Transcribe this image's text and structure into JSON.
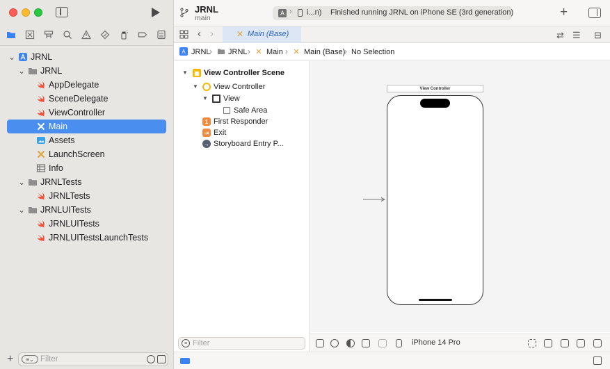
{
  "sidebar": {
    "nav_tabs": [
      "project-navigator",
      "source-control",
      "symbol-navigator",
      "find-navigator",
      "issue-navigator",
      "test-navigator",
      "debug-navigator",
      "breakpoint-navigator",
      "report-navigator"
    ],
    "tree": [
      {
        "label": "JRNL",
        "icon": "app-project-icon",
        "level": 0,
        "disclosure": "open"
      },
      {
        "label": "JRNL",
        "icon": "folder-icon",
        "level": 1,
        "disclosure": "open"
      },
      {
        "label": "AppDelegate",
        "icon": "swift-icon",
        "level": 2
      },
      {
        "label": "SceneDelegate",
        "icon": "swift-icon",
        "level": 2
      },
      {
        "label": "ViewController",
        "icon": "swift-icon",
        "level": 2
      },
      {
        "label": "Main",
        "icon": "storyboard-icon",
        "level": 2,
        "selected": true
      },
      {
        "label": "Assets",
        "icon": "assets-icon",
        "level": 2
      },
      {
        "label": "LaunchScreen",
        "icon": "storyboard-icon",
        "level": 2
      },
      {
        "label": "Info",
        "icon": "plist-icon",
        "level": 2
      },
      {
        "label": "JRNLTests",
        "icon": "folder-icon",
        "level": 1,
        "disclosure": "open"
      },
      {
        "label": "JRNLTests",
        "icon": "swift-icon",
        "level": 2
      },
      {
        "label": "JRNLUITests",
        "icon": "folder-icon",
        "level": 1,
        "disclosure": "open"
      },
      {
        "label": "JRNLUITests",
        "icon": "swift-icon",
        "level": 2
      },
      {
        "label": "JRNLUITestsLaunchTests",
        "icon": "swift-icon",
        "level": 2
      }
    ],
    "filter_placeholder": "Filter"
  },
  "toolbar": {
    "project_title": "JRNL",
    "branch": "main",
    "scheme_device_short": "i...n)",
    "status": "Finished running JRNL on iPhone SE (3rd generation)"
  },
  "tabbar": {
    "active_tab": "Main (Base)"
  },
  "breadcrumb": [
    "JRNL",
    "JRNL",
    "Main",
    "Main (Base)",
    "No Selection"
  ],
  "outline": {
    "rows": [
      {
        "label": "View Controller Scene",
        "bold": true
      },
      {
        "label": "View Controller"
      },
      {
        "label": "View"
      },
      {
        "label": "Safe Area"
      },
      {
        "label": "First Responder"
      },
      {
        "label": "Exit"
      },
      {
        "label": "Storyboard Entry P..."
      }
    ],
    "filter_placeholder": "Filter"
  },
  "canvas": {
    "scene_title": "View Controller",
    "device": "iPhone 14 Pro"
  },
  "colors": {
    "selection": "#4a8ff0",
    "swift": "#f05138",
    "storyboard": "#e0a23b",
    "accent": "#3b82f6"
  }
}
